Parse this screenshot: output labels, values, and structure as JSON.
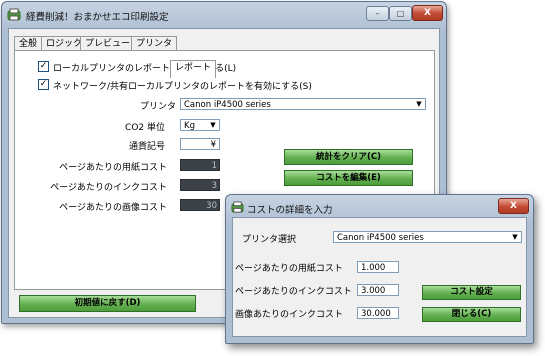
{
  "main_window": {
    "title": "経費削減！おまかせエコ印刷設定",
    "controls": {
      "minimize": "–",
      "maximize": "□",
      "close": "X"
    },
    "tabs": [
      {
        "label": "全般"
      },
      {
        "label": "ロジック"
      },
      {
        "label": "プレビュー"
      },
      {
        "label": "プリンタ"
      },
      {
        "label": "レポート"
      }
    ],
    "checkbox_local": {
      "label": "ローカルプリンタのレポートを有効にする(L)",
      "checked": true
    },
    "checkbox_network": {
      "label": "ネットワーク/共有ローカルプリンタのレポートを有効にする(S)",
      "checked": true
    },
    "printer_label": "プリンタ",
    "printer_value": "Canon iP4500 series",
    "co2_label": "CO2 単位",
    "co2_value": "Kg",
    "currency_label": "通貨記号",
    "currency_value": "¥",
    "paper_cost_label": "ページあたりの用紙コスト",
    "paper_cost_value": "1",
    "ink_cost_label": "ページあたりのインクコスト",
    "ink_cost_value": "3",
    "image_cost_label": "ページあたりの画像コスト",
    "image_cost_value": "30",
    "clear_stats_button": "統計をクリア(C)",
    "edit_cost_button": "コストを編集(E)",
    "reset_button": "初期値に戻す(D)"
  },
  "cost_dialog": {
    "title": "コストの詳細を入力",
    "close": "X",
    "printer_select_label": "プリンタ選択",
    "printer_value": "Canon iP4500 series",
    "paper_cost_label": "ページあたりの用紙コスト",
    "paper_cost_value": "1.000",
    "ink_cost_label": "ページあたりのインクコスト",
    "ink_cost_value": "3.000",
    "image_ink_label": "画像あたりのインクコスト",
    "image_ink_value": "30.000",
    "set_cost_button": "コスト設定",
    "close_button": "閉じる(C)"
  }
}
